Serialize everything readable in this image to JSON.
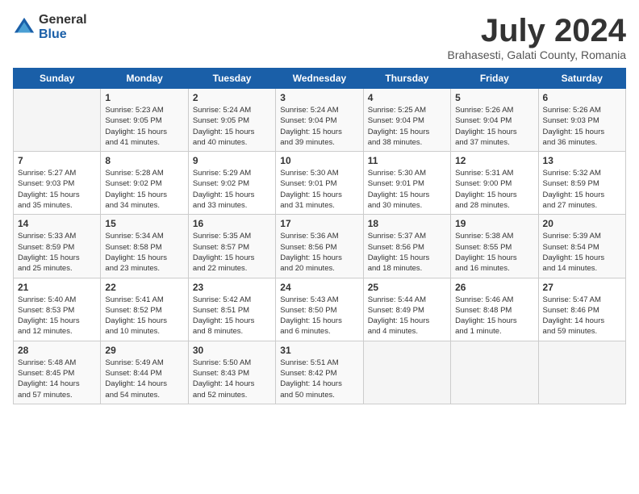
{
  "header": {
    "logo_general": "General",
    "logo_blue": "Blue",
    "month_title": "July 2024",
    "subtitle": "Brahasesti, Galati County, Romania"
  },
  "calendar": {
    "days_of_week": [
      "Sunday",
      "Monday",
      "Tuesday",
      "Wednesday",
      "Thursday",
      "Friday",
      "Saturday"
    ],
    "weeks": [
      [
        {
          "day": "",
          "info": ""
        },
        {
          "day": "1",
          "info": "Sunrise: 5:23 AM\nSunset: 9:05 PM\nDaylight: 15 hours\nand 41 minutes."
        },
        {
          "day": "2",
          "info": "Sunrise: 5:24 AM\nSunset: 9:05 PM\nDaylight: 15 hours\nand 40 minutes."
        },
        {
          "day": "3",
          "info": "Sunrise: 5:24 AM\nSunset: 9:04 PM\nDaylight: 15 hours\nand 39 minutes."
        },
        {
          "day": "4",
          "info": "Sunrise: 5:25 AM\nSunset: 9:04 PM\nDaylight: 15 hours\nand 38 minutes."
        },
        {
          "day": "5",
          "info": "Sunrise: 5:26 AM\nSunset: 9:04 PM\nDaylight: 15 hours\nand 37 minutes."
        },
        {
          "day": "6",
          "info": "Sunrise: 5:26 AM\nSunset: 9:03 PM\nDaylight: 15 hours\nand 36 minutes."
        }
      ],
      [
        {
          "day": "7",
          "info": "Sunrise: 5:27 AM\nSunset: 9:03 PM\nDaylight: 15 hours\nand 35 minutes."
        },
        {
          "day": "8",
          "info": "Sunrise: 5:28 AM\nSunset: 9:02 PM\nDaylight: 15 hours\nand 34 minutes."
        },
        {
          "day": "9",
          "info": "Sunrise: 5:29 AM\nSunset: 9:02 PM\nDaylight: 15 hours\nand 33 minutes."
        },
        {
          "day": "10",
          "info": "Sunrise: 5:30 AM\nSunset: 9:01 PM\nDaylight: 15 hours\nand 31 minutes."
        },
        {
          "day": "11",
          "info": "Sunrise: 5:30 AM\nSunset: 9:01 PM\nDaylight: 15 hours\nand 30 minutes."
        },
        {
          "day": "12",
          "info": "Sunrise: 5:31 AM\nSunset: 9:00 PM\nDaylight: 15 hours\nand 28 minutes."
        },
        {
          "day": "13",
          "info": "Sunrise: 5:32 AM\nSunset: 8:59 PM\nDaylight: 15 hours\nand 27 minutes."
        }
      ],
      [
        {
          "day": "14",
          "info": "Sunrise: 5:33 AM\nSunset: 8:59 PM\nDaylight: 15 hours\nand 25 minutes."
        },
        {
          "day": "15",
          "info": "Sunrise: 5:34 AM\nSunset: 8:58 PM\nDaylight: 15 hours\nand 23 minutes."
        },
        {
          "day": "16",
          "info": "Sunrise: 5:35 AM\nSunset: 8:57 PM\nDaylight: 15 hours\nand 22 minutes."
        },
        {
          "day": "17",
          "info": "Sunrise: 5:36 AM\nSunset: 8:56 PM\nDaylight: 15 hours\nand 20 minutes."
        },
        {
          "day": "18",
          "info": "Sunrise: 5:37 AM\nSunset: 8:56 PM\nDaylight: 15 hours\nand 18 minutes."
        },
        {
          "day": "19",
          "info": "Sunrise: 5:38 AM\nSunset: 8:55 PM\nDaylight: 15 hours\nand 16 minutes."
        },
        {
          "day": "20",
          "info": "Sunrise: 5:39 AM\nSunset: 8:54 PM\nDaylight: 15 hours\nand 14 minutes."
        }
      ],
      [
        {
          "day": "21",
          "info": "Sunrise: 5:40 AM\nSunset: 8:53 PM\nDaylight: 15 hours\nand 12 minutes."
        },
        {
          "day": "22",
          "info": "Sunrise: 5:41 AM\nSunset: 8:52 PM\nDaylight: 15 hours\nand 10 minutes."
        },
        {
          "day": "23",
          "info": "Sunrise: 5:42 AM\nSunset: 8:51 PM\nDaylight: 15 hours\nand 8 minutes."
        },
        {
          "day": "24",
          "info": "Sunrise: 5:43 AM\nSunset: 8:50 PM\nDaylight: 15 hours\nand 6 minutes."
        },
        {
          "day": "25",
          "info": "Sunrise: 5:44 AM\nSunset: 8:49 PM\nDaylight: 15 hours\nand 4 minutes."
        },
        {
          "day": "26",
          "info": "Sunrise: 5:46 AM\nSunset: 8:48 PM\nDaylight: 15 hours\nand 1 minute."
        },
        {
          "day": "27",
          "info": "Sunrise: 5:47 AM\nSunset: 8:46 PM\nDaylight: 14 hours\nand 59 minutes."
        }
      ],
      [
        {
          "day": "28",
          "info": "Sunrise: 5:48 AM\nSunset: 8:45 PM\nDaylight: 14 hours\nand 57 minutes."
        },
        {
          "day": "29",
          "info": "Sunrise: 5:49 AM\nSunset: 8:44 PM\nDaylight: 14 hours\nand 54 minutes."
        },
        {
          "day": "30",
          "info": "Sunrise: 5:50 AM\nSunset: 8:43 PM\nDaylight: 14 hours\nand 52 minutes."
        },
        {
          "day": "31",
          "info": "Sunrise: 5:51 AM\nSunset: 8:42 PM\nDaylight: 14 hours\nand 50 minutes."
        },
        {
          "day": "",
          "info": ""
        },
        {
          "day": "",
          "info": ""
        },
        {
          "day": "",
          "info": ""
        }
      ]
    ]
  }
}
